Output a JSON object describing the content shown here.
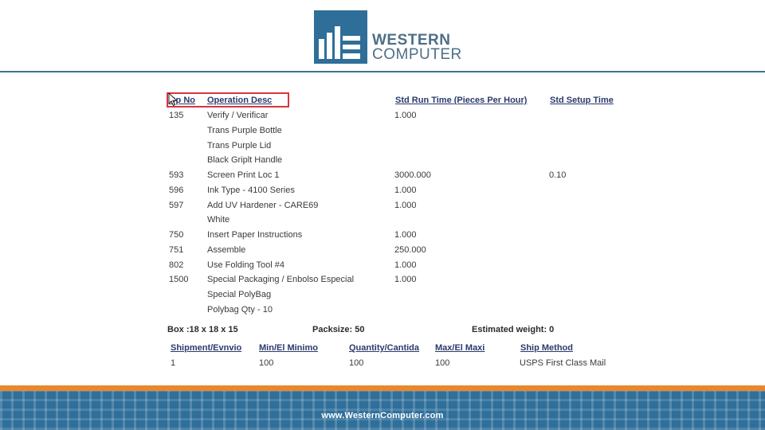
{
  "logo": {
    "line1": "WESTERN",
    "line2": "COMPUTER"
  },
  "ops_header": {
    "op_no": "Op No",
    "operation_desc": "Operation Desc",
    "std_run_time": "Std Run Time (Pieces Per Hour)",
    "std_setup_time": "Std Setup Time"
  },
  "ops_rows": [
    {
      "op": "135",
      "desc": "Verify / Verificar",
      "run": "1.000",
      "setup": ""
    },
    {
      "op": "",
      "desc": "Trans Purple Bottle",
      "run": "",
      "setup": ""
    },
    {
      "op": "",
      "desc": "Trans Purple Lid",
      "run": "",
      "setup": ""
    },
    {
      "op": "",
      "desc": "Black Griplt Handle",
      "run": "",
      "setup": ""
    },
    {
      "op": "593",
      "desc": "Screen Print Loc 1",
      "run": "3000.000",
      "setup": "0.10"
    },
    {
      "op": "596",
      "desc": "Ink Type  - 4100 Series",
      "run": "1.000",
      "setup": ""
    },
    {
      "op": "597",
      "desc": "Add UV Hardener - CARE69",
      "run": "1.000",
      "setup": ""
    },
    {
      "op": "",
      "desc": "White",
      "run": "",
      "setup": ""
    },
    {
      "op": "750",
      "desc": "Insert Paper Instructions",
      "run": "1.000",
      "setup": ""
    },
    {
      "op": "751",
      "desc": "Assemble",
      "run": "250.000",
      "setup": ""
    },
    {
      "op": "802",
      "desc": "Use Folding Tool #4",
      "run": "1.000",
      "setup": ""
    },
    {
      "op": "1500",
      "desc": "Special Packaging / Enbolso Especial",
      "run": "1.000",
      "setup": ""
    },
    {
      "op": "",
      "desc": "Special PolyBag",
      "run": "",
      "setup": ""
    },
    {
      "op": "",
      "desc": "Polybag Qty - 10",
      "run": "",
      "setup": ""
    }
  ],
  "box_info": {
    "box": "Box :18 x 18 x 15",
    "packsize": "Packsize: 50",
    "weight": "Estimated weight: 0"
  },
  "ship_header": {
    "shipment": "Shipment/Evnvio",
    "min": "Min/El Minimo",
    "qty": "Quantity/Cantida",
    "max": "Max/El Maxi",
    "method": "Ship Method"
  },
  "ship_row": {
    "shipment": "1",
    "min": "100",
    "qty": "100",
    "max": "100",
    "method": "USPS First Class Mail"
  },
  "footer": {
    "url": "www.WesternComputer.com"
  },
  "colors": {
    "brand_blue": "#2e6e99",
    "orange": "#e8872e",
    "highlight": "#d9363e"
  },
  "icons": {
    "cursor": "mouse-pointer-icon"
  }
}
